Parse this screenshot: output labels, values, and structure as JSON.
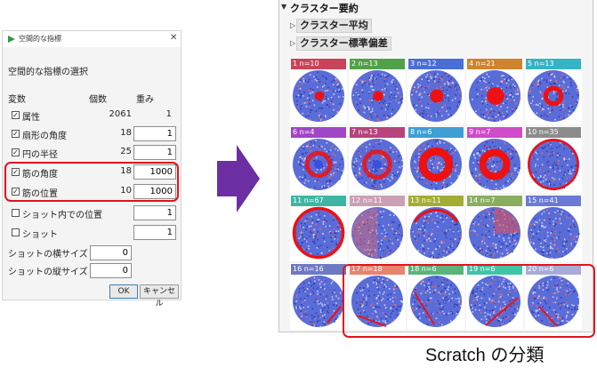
{
  "dialog": {
    "title": "空間的な指標",
    "heading": "空間的な指標の選択",
    "col_var": "変数",
    "col_count": "個数",
    "col_weight": "重み",
    "rows": [
      {
        "name": "属性",
        "checked": true,
        "count": "2061",
        "weight": "1",
        "editable": false
      },
      {
        "name": "扇形の角度",
        "checked": true,
        "count": "18",
        "weight": "1",
        "editable": true
      },
      {
        "name": "円の半径",
        "checked": true,
        "count": "25",
        "weight": "1",
        "editable": true
      },
      {
        "name": "筋の角度",
        "checked": true,
        "count": "18",
        "weight": "1000",
        "editable": true
      },
      {
        "name": "筋の位置",
        "checked": true,
        "count": "10",
        "weight": "1000",
        "editable": true
      },
      {
        "name": "ショット内での位置",
        "checked": false,
        "count": "",
        "weight": "1",
        "editable": true
      },
      {
        "name": "ショット",
        "checked": false,
        "count": "",
        "weight": "1",
        "editable": true
      }
    ],
    "shot_width_label": "ショットの横サイズ",
    "shot_width_value": "0",
    "shot_height_label": "ショットの縦サイズ",
    "shot_height_value": "0",
    "ok_label": "OK",
    "cancel_label": "キャンセル",
    "close_glyph": "✕"
  },
  "panel": {
    "title": "クラスター要約",
    "sub1": "クラスター平均",
    "sub2": "クラスター標準偏差",
    "clusters": [
      {
        "label": "1  n=10",
        "color": "#c94459",
        "pattern": "blob",
        "size": 0.18
      },
      {
        "label": "2  n=13",
        "color": "#53a04a",
        "pattern": "blob",
        "size": 0.2
      },
      {
        "label": "3  n=12",
        "color": "#4a6fd4",
        "pattern": "blob",
        "size": 0.26
      },
      {
        "label": "4  n=21",
        "color": "#d0832f",
        "pattern": "blob",
        "size": 0.34
      },
      {
        "label": "5  n=13",
        "color": "#34b4c4",
        "pattern": "ring",
        "size": 0.4
      },
      {
        "label": "6  n=4",
        "color": "#a046c6",
        "pattern": "ringcenter",
        "size": 0.55
      },
      {
        "label": "7  n=13",
        "color": "#b5457a",
        "pattern": "ringcenter",
        "size": 0.62
      },
      {
        "label": "8  n=6",
        "color": "#3d9fd4",
        "pattern": "ring",
        "size": 0.68
      },
      {
        "label": "9  n=7",
        "color": "#cf4bc8",
        "pattern": "ring",
        "size": 0.62
      },
      {
        "label": "10  n=35",
        "color": "#8c8c8c",
        "pattern": "edge",
        "size": 0.2
      },
      {
        "label": "11  n=67",
        "color": "#3fb6a4",
        "pattern": "edge",
        "size": 0.5
      },
      {
        "label": "12  n=11",
        "color": "#c9a0b4",
        "pattern": "lefthalf",
        "size": 0.0
      },
      {
        "label": "13  n=11",
        "color": "#a3ad36",
        "pattern": "edgeTop",
        "size": 0.0
      },
      {
        "label": "14  n=7",
        "color": "#8aae5f",
        "pattern": "topright",
        "size": 0.0
      },
      {
        "label": "15  n=41",
        "color": "#6a7ad6",
        "pattern": "plain",
        "size": 0.0
      },
      {
        "label": "16  n=16",
        "color": "#6e79c4",
        "pattern": "scratchBR",
        "size": 0.0
      },
      {
        "label": "17  n=18",
        "color": "#e8836e",
        "pattern": "scratchBot",
        "size": 0.0
      },
      {
        "label": "18  n=6",
        "color": "#5bb47a",
        "pattern": "scratchL",
        "size": 0.0
      },
      {
        "label": "19  n=6",
        "color": "#3fc4a6",
        "pattern": "scratchDiag",
        "size": 0.0
      },
      {
        "label": "20  n=6",
        "color": "#a8abd6",
        "pattern": "scratchV",
        "size": 0.0
      }
    ]
  },
  "caption": "Scratch の分類",
  "colors": {
    "highlight": "#e0141b",
    "arrow": "#6b2fa3",
    "wafer_base": "#5a6cd8",
    "defect": "#ee1111"
  }
}
